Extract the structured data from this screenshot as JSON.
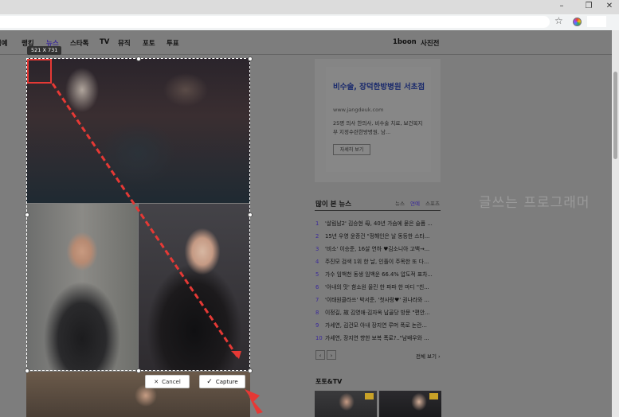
{
  "browser": {
    "window_controls": [
      "–",
      "❐",
      "✕"
    ],
    "icons": [
      "star-icon",
      "extension-icon"
    ]
  },
  "nav": {
    "items": [
      "뮤직예",
      "랭킹",
      "뉴스",
      "스타톡",
      "TV",
      "뮤직",
      "포토",
      "투표"
    ],
    "active_index": 2,
    "right_items": [
      "1boon",
      "사진전"
    ]
  },
  "capture": {
    "size_label": "521 X 731",
    "cancel_label": "Cancel",
    "capture_label": "Capture",
    "accent_color": "#e53935"
  },
  "ad": {
    "title": "비수술, 장덕한방병원 서초점",
    "url": "www.jangdeuk.com",
    "description": "25명 의사 한의사, 비수술 치료, 보건복지부 지정수련한방병원, 남...",
    "button_label": "자세히 보기"
  },
  "watermark": "글쓰는 프로그래머",
  "popular": {
    "title": "많이 본 뉴스",
    "tabs": [
      "뉴스",
      "연예",
      "스포츠"
    ],
    "active_tab": 1,
    "items": [
      {
        "rank": "1",
        "text": "'살림남2' 김승현 母, 40년 가슴에 묻은 슬픔 ..."
      },
      {
        "rank": "2",
        "text": "15년 우영 윤종건 \"정해인은 날 동등한 스타..."
      },
      {
        "rank": "3",
        "text": "'비소' 이승준, 16살 연하 ♥김소니아 고백→..."
      },
      {
        "rank": "4",
        "text": "주진모 검색 1위 한 날, 인플이 주목한 또 다..."
      },
      {
        "rank": "5",
        "text": "가수 임백천 동생 임백운 66.4% 압도적 표차..."
      },
      {
        "rank": "6",
        "text": "'아내의 맛' 함소원 울린 한 파파 한 마디 \"친..."
      },
      {
        "rank": "7",
        "text": "'이태원클라쓰' 박서준, '첫사랑♥' 권나라와 ..."
      },
      {
        "rank": "8",
        "text": "이정길, 故 김영애·김자옥 납골당 방문 \"편안..."
      },
      {
        "rank": "9",
        "text": "가세연, 김건모 아내 장지연 루머 폭로 논란..."
      },
      {
        "rank": "10",
        "text": "가세연, 장지연 향한 보복 폭로?..\"남배우와 ..."
      }
    ],
    "prev": "‹",
    "next": "›",
    "more_label": "전체 보기 ›"
  },
  "photo_tv": {
    "title": "포토&TV"
  }
}
